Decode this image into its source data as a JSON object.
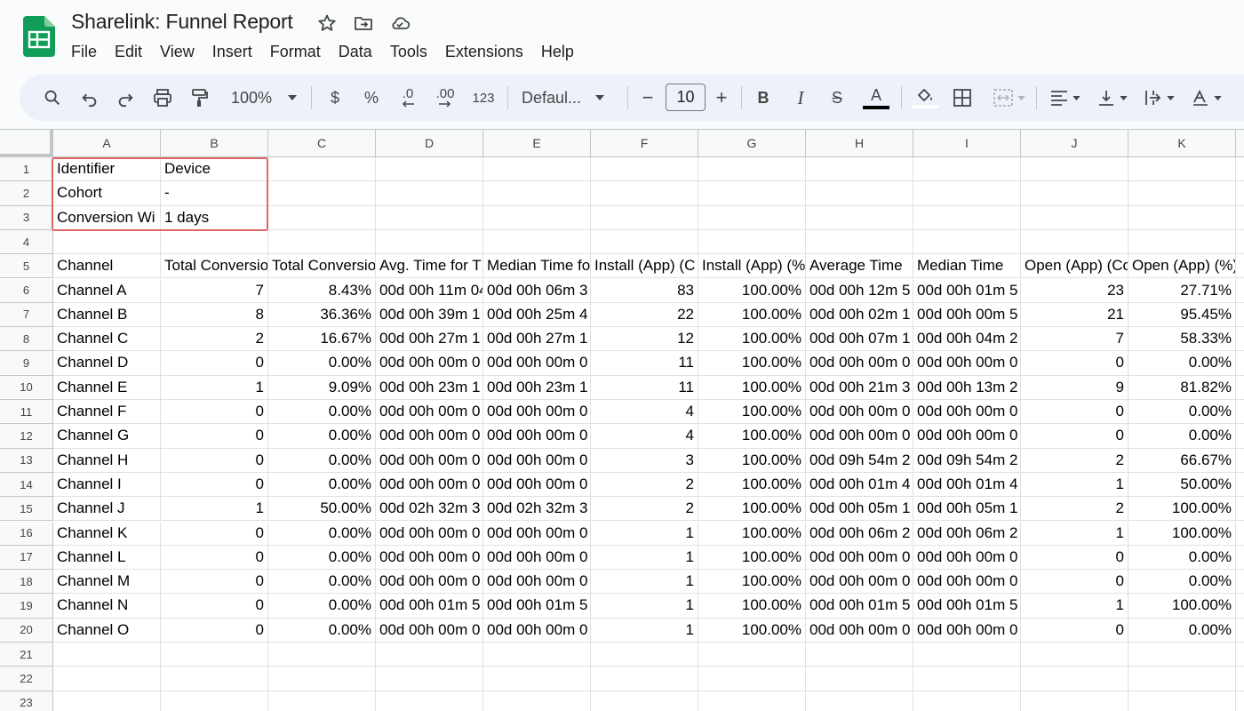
{
  "title": "Sharelink: Funnel Report",
  "menu": [
    "File",
    "Edit",
    "View",
    "Insert",
    "Format",
    "Data",
    "Tools",
    "Extensions",
    "Help"
  ],
  "toolbar": {
    "zoom": "100%",
    "currency": "$",
    "percent": "%",
    "dec_decrease": ".0",
    "dec_increase": ".00",
    "number_format": "123",
    "font": "Defaul...",
    "font_size": "10",
    "minus": "−",
    "plus": "+",
    "bold": "B",
    "italic": "I",
    "strike": "S",
    "text_color": "A"
  },
  "columns": [
    "A",
    "B",
    "C",
    "D",
    "E",
    "F",
    "G",
    "H",
    "I",
    "J",
    "K"
  ],
  "rows": [
    [
      "Identifier",
      "Device",
      "",
      "",
      "",
      "",
      "",
      "",
      "",
      "",
      ""
    ],
    [
      "Cohort",
      "-",
      "",
      "",
      "",
      "",
      "",
      "",
      "",
      "",
      ""
    ],
    [
      "Conversion Wi",
      "1 days",
      "",
      "",
      "",
      "",
      "",
      "",
      "",
      "",
      ""
    ],
    [
      "",
      "",
      "",
      "",
      "",
      "",
      "",
      "",
      "",
      "",
      ""
    ],
    [
      "Channel",
      "Total Conversio",
      "Total Conversio",
      "Avg. Time for T",
      "Median Time fo",
      "Install (App) (C",
      "Install (App) (%",
      "Average Time",
      "Median Time",
      "Open (App) (Co",
      "Open (App) (%)"
    ],
    [
      "Channel A",
      "7",
      "8.43%",
      "00d 00h 11m 04",
      "00d 00h 06m 3",
      "83",
      "100.00%",
      "00d 00h 12m 5",
      "00d 00h 01m 5",
      "23",
      "27.71%"
    ],
    [
      "Channel B",
      "8",
      "36.36%",
      "00d 00h 39m 1",
      "00d 00h 25m 4",
      "22",
      "100.00%",
      "00d 00h 02m 1",
      "00d 00h 00m 5",
      "21",
      "95.45%"
    ],
    [
      "Channel C",
      "2",
      "16.67%",
      "00d 00h 27m 1",
      "00d 00h 27m 1",
      "12",
      "100.00%",
      "00d 00h 07m 1",
      "00d 00h 04m 2",
      "7",
      "58.33%"
    ],
    [
      "Channel D",
      "0",
      "0.00%",
      "00d 00h 00m 0",
      "00d 00h 00m 0",
      "11",
      "100.00%",
      "00d 00h 00m 0",
      "00d 00h 00m 0",
      "0",
      "0.00%"
    ],
    [
      "Channel E",
      "1",
      "9.09%",
      "00d 00h 23m 1",
      "00d 00h 23m 1",
      "11",
      "100.00%",
      "00d 00h 21m 3",
      "00d 00h 13m 2",
      "9",
      "81.82%"
    ],
    [
      "Channel F",
      "0",
      "0.00%",
      "00d 00h 00m 0",
      "00d 00h 00m 0",
      "4",
      "100.00%",
      "00d 00h 00m 0",
      "00d 00h 00m 0",
      "0",
      "0.00%"
    ],
    [
      "Channel G",
      "0",
      "0.00%",
      "00d 00h 00m 0",
      "00d 00h 00m 0",
      "4",
      "100.00%",
      "00d 00h 00m 0",
      "00d 00h 00m 0",
      "0",
      "0.00%"
    ],
    [
      "Channel H",
      "0",
      "0.00%",
      "00d 00h 00m 0",
      "00d 00h 00m 0",
      "3",
      "100.00%",
      "00d 09h 54m 2",
      "00d 09h 54m 2",
      "2",
      "66.67%"
    ],
    [
      "Channel I",
      "0",
      "0.00%",
      "00d 00h 00m 0",
      "00d 00h 00m 0",
      "2",
      "100.00%",
      "00d 00h 01m 4",
      "00d 00h 01m 4",
      "1",
      "50.00%"
    ],
    [
      "Channel J",
      "1",
      "50.00%",
      "00d 02h 32m 3",
      "00d 02h 32m 3",
      "2",
      "100.00%",
      "00d 00h 05m 1",
      "00d 00h 05m 1",
      "2",
      "100.00%"
    ],
    [
      "Channel K",
      "0",
      "0.00%",
      "00d 00h 00m 0",
      "00d 00h 00m 0",
      "1",
      "100.00%",
      "00d 00h 06m 2",
      "00d 00h 06m 2",
      "1",
      "100.00%"
    ],
    [
      "Channel L",
      "0",
      "0.00%",
      "00d 00h 00m 0",
      "00d 00h 00m 0",
      "1",
      "100.00%",
      "00d 00h 00m 0",
      "00d 00h 00m 0",
      "0",
      "0.00%"
    ],
    [
      "Channel M",
      "0",
      "0.00%",
      "00d 00h 00m 0",
      "00d 00h 00m 0",
      "1",
      "100.00%",
      "00d 00h 00m 0",
      "00d 00h 00m 0",
      "0",
      "0.00%"
    ],
    [
      "Channel N",
      "0",
      "0.00%",
      "00d 00h 01m 5",
      "00d 00h 01m 5",
      "1",
      "100.00%",
      "00d 00h 01m 5",
      "00d 00h 01m 5",
      "1",
      "100.00%"
    ],
    [
      "Channel O",
      "0",
      "0.00%",
      "00d 00h 00m 0",
      "00d 00h 00m 0",
      "1",
      "100.00%",
      "00d 00h 00m 0",
      "00d 00h 00m 0",
      "0",
      "0.00%"
    ],
    [
      "",
      "",
      "",
      "",
      "",
      "",
      "",
      "",
      "",
      "",
      ""
    ],
    [
      "",
      "",
      "",
      "",
      "",
      "",
      "",
      "",
      "",
      "",
      ""
    ],
    [
      "",
      "",
      "",
      "",
      "",
      "",
      "",
      "",
      "",
      "",
      ""
    ]
  ],
  "colors": {
    "sheets_green": "#0f9d58",
    "toolbar_bg": "#edf2fa",
    "selection_border": "#e06666"
  }
}
